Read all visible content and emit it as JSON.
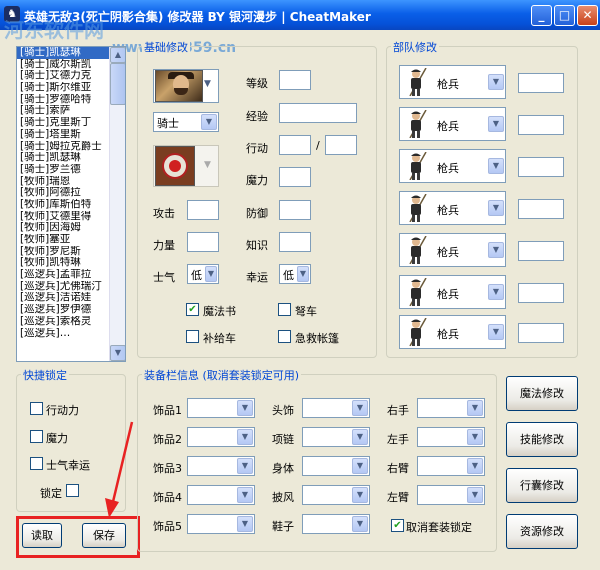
{
  "window": {
    "title": "英雄无敌3(死亡阴影合集) 修改器 BY 银河漫步 | CheatMaker",
    "watermark": "河东软件网",
    "watermark_url": "www.pc0359.cn"
  },
  "char_list": {
    "selected": "[骑士]凯瑟琳",
    "items": [
      "[骑士]凯瑟琳",
      "[骑士]威尔斯凯",
      "[骑士]艾德力克",
      "[骑士]斯尔维亚",
      "[骑士]罗德哈特",
      "[骑士]索萨",
      "[骑士]克里斯丁",
      "[骑士]塔里斯",
      "[骑士]姆拉克爵士",
      "[骑士]凯瑟琳",
      "[骑士]罗兰德",
      "[牧师]瑞恩",
      "[牧师]阿德拉",
      "[牧师]库斯伯特",
      "[牧师]艾德里得",
      "[牧师]因海姆",
      "[牧师]塞亚",
      "[牧师]罗尼斯",
      "[牧师]凯特琳",
      "[巡逻兵]孟菲拉",
      "[巡逻兵]尤佛瑞汀",
      "[巡逻兵]洁诺娃",
      "[巡逻兵]罗伊德",
      "[巡逻兵]索格灵",
      "[巡逻兵]…"
    ]
  },
  "basic": {
    "group_label": "基础修改",
    "class_value": "骑士",
    "labels": {
      "level": "等级",
      "exp": "经验",
      "move": "行动",
      "slash": "/",
      "mana": "魔力",
      "attack": "攻击",
      "defense": "防御",
      "power": "力量",
      "knowledge": "知识",
      "morale": "士气",
      "luck": "幸运"
    },
    "morale_value": "低",
    "luck_value": "低",
    "checks": {
      "spellbook": "魔法书",
      "ballista": "弩车",
      "ammo_cart": "补给车",
      "first_aid_tent": "急救帐篷"
    }
  },
  "army": {
    "group_label": "部队修改",
    "slots": [
      "枪兵",
      "枪兵",
      "枪兵",
      "枪兵",
      "枪兵",
      "枪兵",
      "枪兵"
    ]
  },
  "quick_lock": {
    "group_label": "快捷锁定",
    "move": "行动力",
    "mana": "魔力",
    "morale_luck": "士气幸运",
    "lock": "锁定"
  },
  "buttons": {
    "read": "读取",
    "save": "保存"
  },
  "equip": {
    "group_label": "装备栏信息 (取消套装锁定可用)",
    "labels": {
      "acc1": "饰品1",
      "acc2": "饰品2",
      "acc3": "饰品3",
      "acc4": "饰品4",
      "acc5": "饰品5",
      "helmet": "头饰",
      "necklace": "项链",
      "armor": "身体",
      "cloak": "披风",
      "boots": "鞋子",
      "right_hand": "右手",
      "left_hand": "左手",
      "right_arm": "右臂",
      "left_arm": "左臂"
    },
    "cancel_set_lock": "取消套装锁定"
  },
  "side_buttons": {
    "magic": "魔法修改",
    "skill": "技能修改",
    "bag": "行囊修改",
    "resource": "资源修改"
  },
  "colors": {
    "titlebar": "#0a5fe8",
    "group_label": "#0046d5",
    "highlight": "#e82222",
    "selection": "#316ac5"
  }
}
